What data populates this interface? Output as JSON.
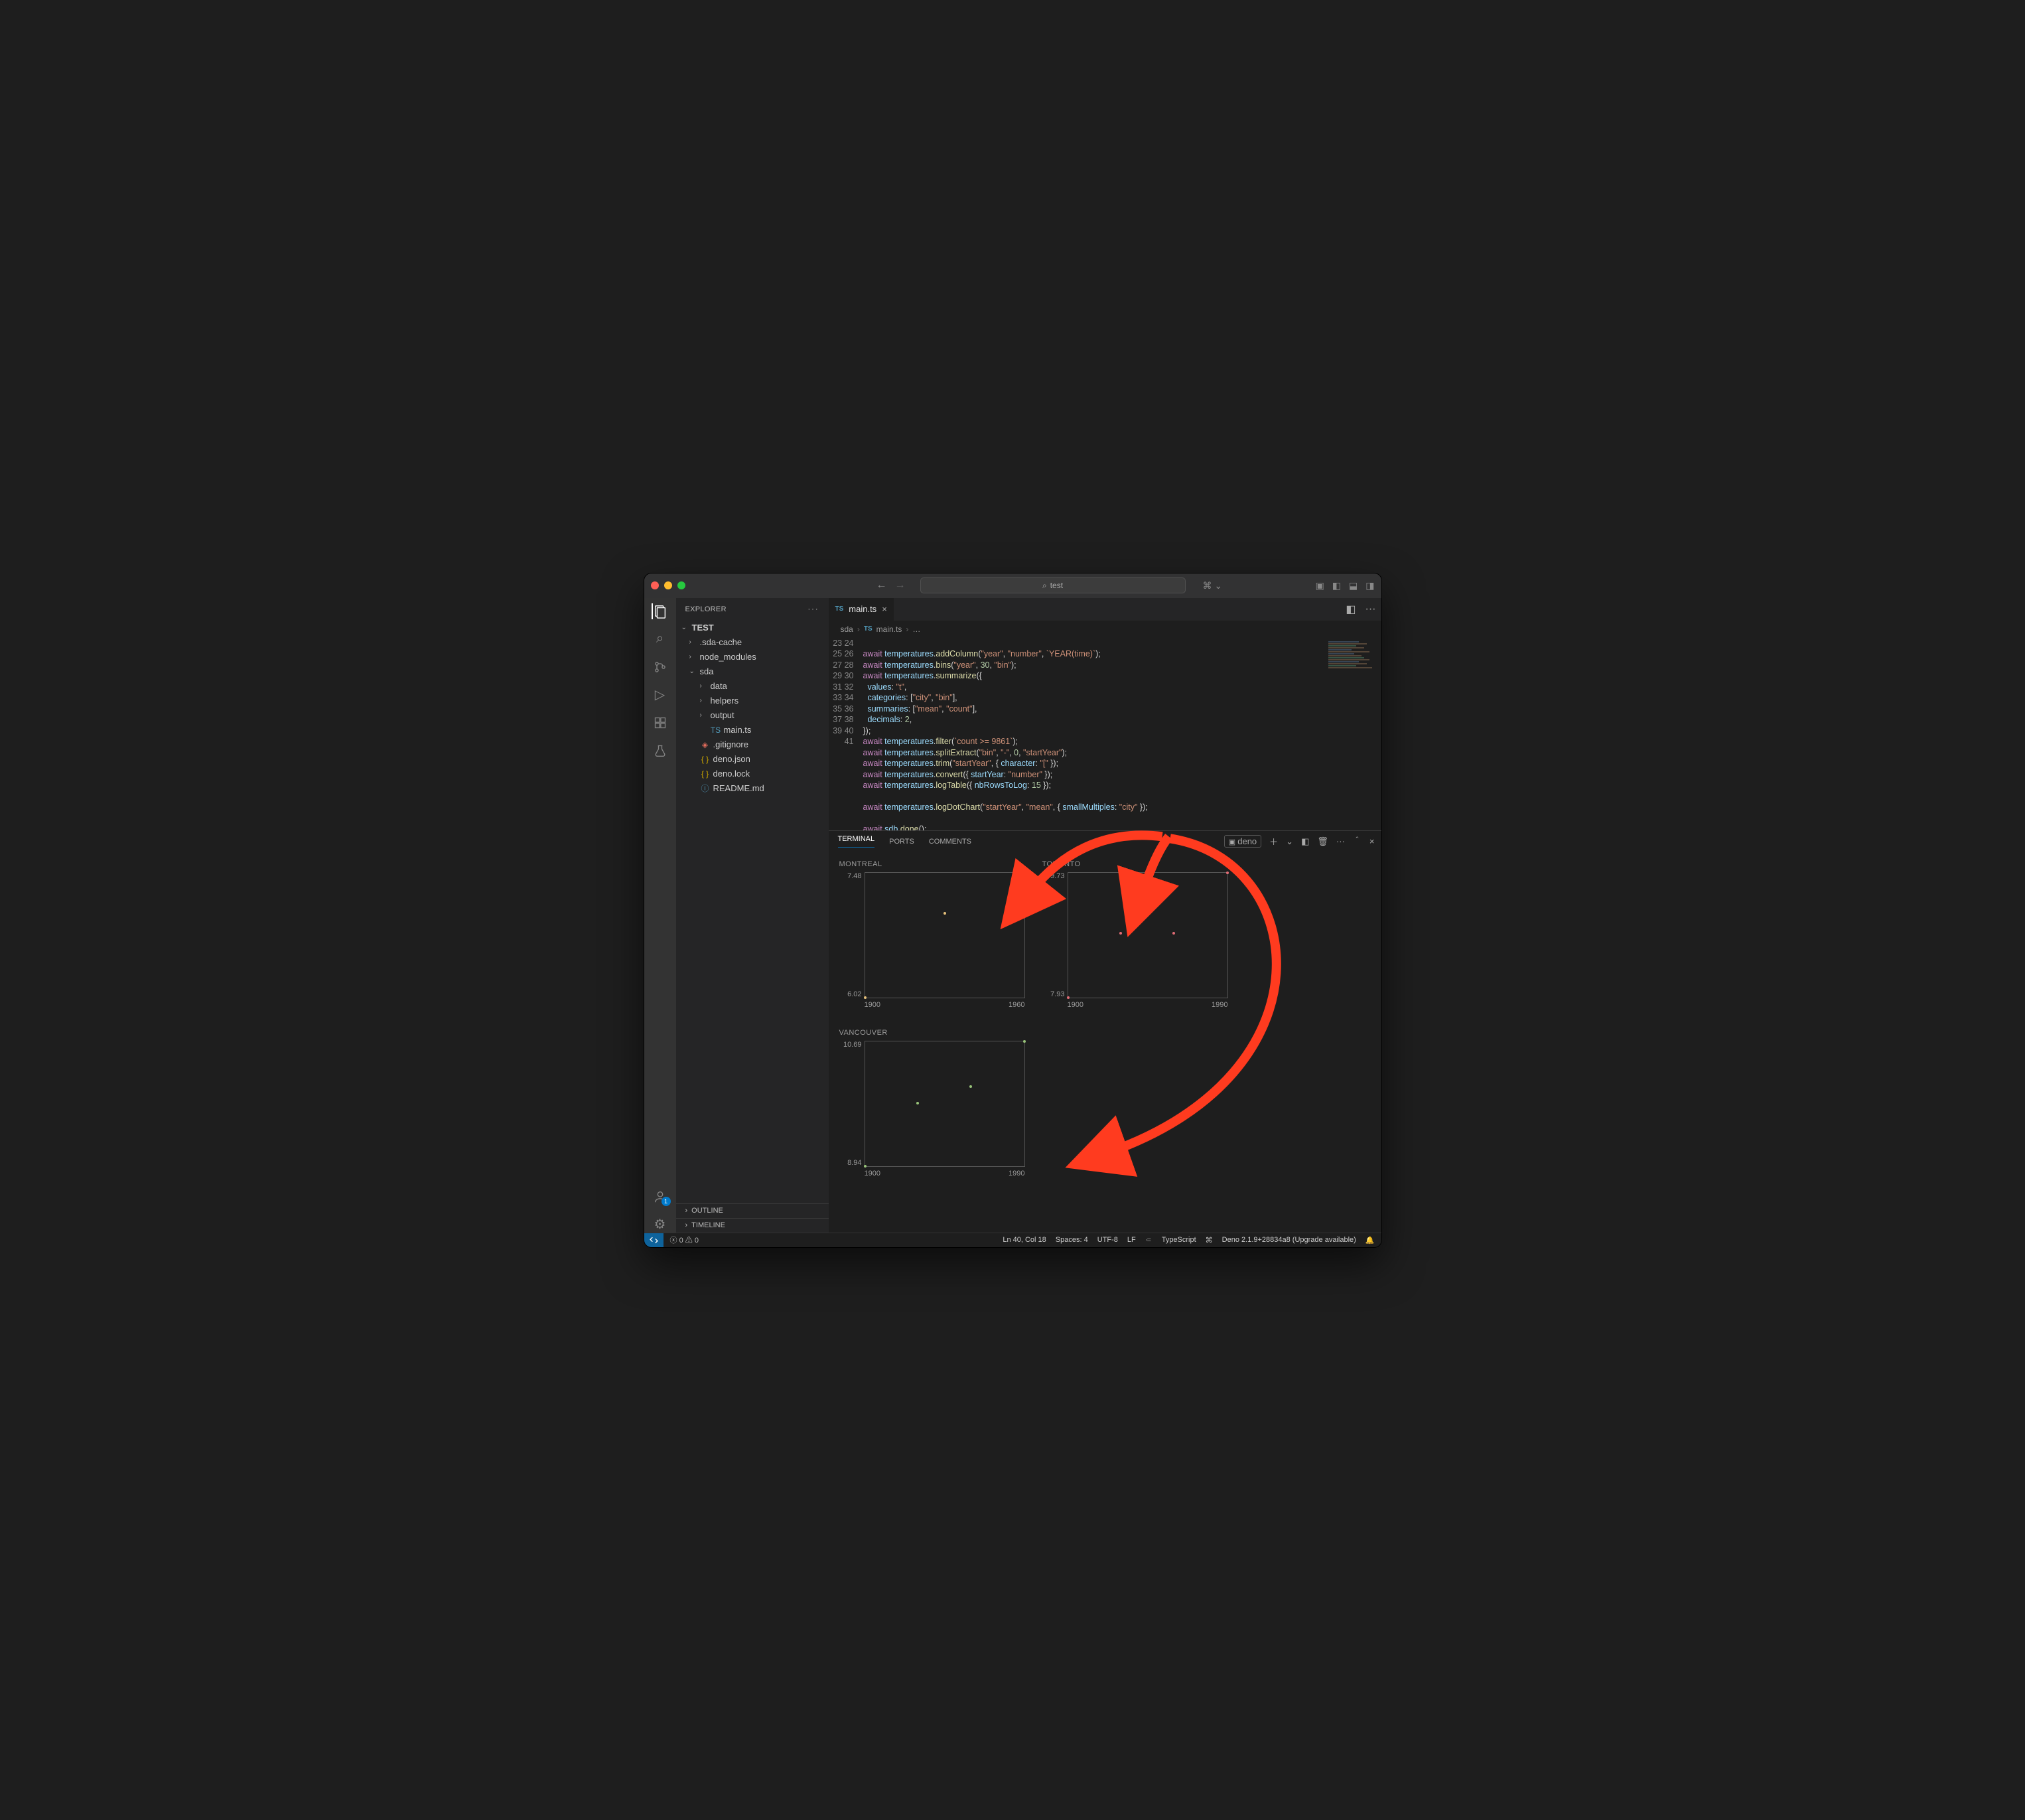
{
  "window": {
    "search_text": "test"
  },
  "explorer": {
    "title": "EXPLORER",
    "root": "TEST",
    "tree": [
      {
        "label": ".sda-cache",
        "type": "folder",
        "depth": 1,
        "open": false
      },
      {
        "label": "node_modules",
        "type": "folder",
        "depth": 1,
        "open": false
      },
      {
        "label": "sda",
        "type": "folder",
        "depth": 1,
        "open": true
      },
      {
        "label": "data",
        "type": "folder",
        "depth": 2,
        "open": false
      },
      {
        "label": "helpers",
        "type": "folder",
        "depth": 2,
        "open": false
      },
      {
        "label": "output",
        "type": "folder",
        "depth": 2,
        "open": false
      },
      {
        "label": "main.ts",
        "type": "ts",
        "depth": 2
      },
      {
        "label": ".gitignore",
        "type": "git",
        "depth": 1
      },
      {
        "label": "deno.json",
        "type": "json",
        "depth": 1
      },
      {
        "label": "deno.lock",
        "type": "json",
        "depth": 1
      },
      {
        "label": "README.md",
        "type": "md",
        "depth": 1
      }
    ],
    "outline": "OUTLINE",
    "timeline": "TIMELINE"
  },
  "tabs": {
    "active": "main.ts",
    "badge": "TS"
  },
  "breadcrumbs": {
    "path": "sda",
    "file": "main.ts",
    "badge": "TS",
    "ellipsis": "…"
  },
  "code": {
    "start_line": 23,
    "raw_lines": [
      "",
      "await temperatures.addColumn(\"year\", \"number\", `YEAR(time)`);",
      "await temperatures.bins(\"year\", 30, \"bin\");",
      "await temperatures.summarize({",
      "  values: \"t\",",
      "  categories: [\"city\", \"bin\"],",
      "  summaries: [\"mean\", \"count\"],",
      "  decimals: 2,",
      "});",
      "await temperatures.filter(`count >= 9861`);",
      "await temperatures.splitExtract(\"bin\", \"-\", 0, \"startYear\");",
      "await temperatures.trim(\"startYear\", { character: \"[\" });",
      "await temperatures.convert({ startYear: \"number\" });",
      "await temperatures.logTable({ nbRowsToLog: 15 });",
      "",
      "await temperatures.logDotChart(\"startYear\", \"mean\", { smallMultiples: \"city\" });",
      "",
      "await sdb.done();",
      ""
    ],
    "html_lines": [
      "",
      "<span class='k'>await</span> <span class='v'>temperatures</span>.<span class='fn'>addColumn</span>(<span class='s'>\"year\"</span>, <span class='s'>\"number\"</span>, <span class='s'>`YEAR(time)`</span>);",
      "<span class='k'>await</span> <span class='v'>temperatures</span>.<span class='fn'>bins</span>(<span class='s'>\"year\"</span>, <span class='n'>30</span>, <span class='s'>\"bin\"</span>);",
      "<span class='k'>await</span> <span class='v'>temperatures</span>.<span class='fn'>summarize</span>({",
      "  <span class='v'>values</span>: <span class='s'>\"t\"</span>,",
      "  <span class='v'>categories</span>: [<span class='s'>\"city\"</span>, <span class='s'>\"bin\"</span>],",
      "  <span class='v'>summaries</span>: [<span class='s'>\"mean\"</span>, <span class='s'>\"count\"</span>],",
      "  <span class='v'>decimals</span>: <span class='n'>2</span>,",
      "});",
      "<span class='k'>await</span> <span class='v'>temperatures</span>.<span class='fn'>filter</span>(<span class='s'>`count &gt;= 9861`</span>);",
      "<span class='k'>await</span> <span class='v'>temperatures</span>.<span class='fn'>splitExtract</span>(<span class='s'>\"bin\"</span>, <span class='s'>\"-\"</span>, <span class='n'>0</span>, <span class='s'>\"startYear\"</span>);",
      "<span class='k'>await</span> <span class='v'>temperatures</span>.<span class='fn'>trim</span>(<span class='s'>\"startYear\"</span>, { <span class='v'>character</span>: <span class='s'>\"[\"</span> });",
      "<span class='k'>await</span> <span class='v'>temperatures</span>.<span class='fn'>convert</span>({ <span class='v'>startYear</span>: <span class='s'>\"number\"</span> });",
      "<span class='k'>await</span> <span class='v'>temperatures</span>.<span class='fn'>logTable</span>({ <span class='v'>nbRowsToLog</span>: <span class='n'>15</span> });",
      "",
      "<span class='k'>await</span> <span class='v'>temperatures</span>.<span class='fn'>logDotChart</span>(<span class='s'>\"startYear\"</span>, <span class='s'>\"mean\"</span>, { <span class='v'>smallMultiples</span>: <span class='s'>\"city\"</span> });",
      "",
      "<span class='k'>await</span> <span class='v'>sdb</span>.<span class='fn'>done</span>();",
      ""
    ]
  },
  "panel": {
    "tabs": [
      "TERMINAL",
      "PORTS",
      "COMMENTS"
    ],
    "active": "TERMINAL",
    "task": "deno"
  },
  "chart_data": [
    {
      "type": "scatter",
      "title": "MONTREAL",
      "color": "#e5c07b",
      "x": [
        1900,
        1930,
        1960
      ],
      "y": [
        6.02,
        7.0,
        7.48
      ],
      "xlim": [
        1900,
        1960
      ],
      "ylim": [
        6.02,
        7.48
      ],
      "xticks": [
        1900,
        1960
      ],
      "yticks": [
        6.02,
        7.48
      ]
    },
    {
      "type": "scatter",
      "title": "TORONTO",
      "color": "#e06c75",
      "x": [
        1900,
        1930,
        1960,
        1990
      ],
      "y": [
        7.93,
        8.85,
        8.85,
        9.73
      ],
      "xlim": [
        1900,
        1990
      ],
      "ylim": [
        7.93,
        9.73
      ],
      "xticks": [
        1900,
        1990
      ],
      "yticks": [
        7.93,
        9.73
      ]
    },
    {
      "type": "scatter",
      "title": "VANCOUVER",
      "color": "#98c379",
      "x": [
        1900,
        1930,
        1960,
        1990
      ],
      "y": [
        8.94,
        9.82,
        10.05,
        10.69
      ],
      "xlim": [
        1900,
        1990
      ],
      "ylim": [
        8.94,
        10.69
      ],
      "xticks": [
        1900,
        1990
      ],
      "yticks": [
        8.94,
        10.69
      ]
    }
  ],
  "statusbar": {
    "errors": "0",
    "warnings": "0",
    "cursor": "Ln 40, Col 18",
    "spaces": "Spaces: 4",
    "encoding": "UTF-8",
    "eol": "LF",
    "language": "TypeScript",
    "deno": "Deno 2.1.9+28834a8 (Upgrade available)"
  }
}
